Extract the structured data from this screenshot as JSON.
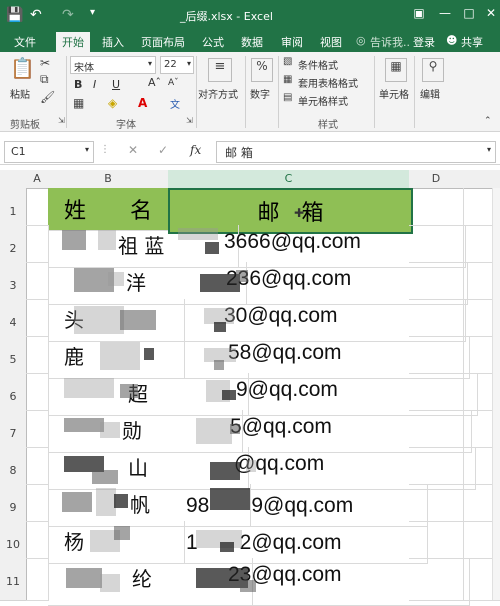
{
  "window": {
    "title": "_后缀.xlsx - Excel"
  },
  "quick_access": {
    "save_icon": "save-icon",
    "undo_icon": "undo-icon",
    "redo_icon": "redo-icon"
  },
  "tabs": [
    "文件",
    "开始",
    "插入",
    "页面布局",
    "公式",
    "数据",
    "审阅",
    "视图"
  ],
  "active_tab": "开始",
  "tell_me": "告诉我..",
  "login": "登录",
  "share": "共享",
  "ribbon": {
    "clipboard": {
      "paste": "粘贴",
      "label": "剪贴板"
    },
    "font": {
      "family": "宋体",
      "size": "22",
      "label": "字体",
      "bold": "B",
      "italic": "I",
      "underline": "U",
      "font_color_glyph": "A"
    },
    "alignment": {
      "label": "对齐方式"
    },
    "number": {
      "label": "数字",
      "glyph": "%"
    },
    "styles": {
      "conditional": "条件格式",
      "table": "套用表格格式",
      "cell_styles": "单元格样式",
      "label": "样式"
    },
    "cells": {
      "label": "单元格"
    },
    "editing": {
      "label": "编辑"
    }
  },
  "formula_bar": {
    "name_box": "C1",
    "fx": "fx",
    "content": "邮 箱"
  },
  "columns": [
    "A",
    "B",
    "C",
    "D"
  ],
  "selected_column": "C",
  "rows": [
    "1",
    "2",
    "3",
    "4",
    "5",
    "6",
    "7",
    "8",
    "9",
    "10",
    "11"
  ],
  "table": {
    "header_name": "姓　　名",
    "header_email": "邮　箱",
    "names": [
      "祖 蓝",
      "洋",
      "头",
      "鹿",
      "超",
      "勋",
      "山",
      "帆",
      "杨",
      "纶"
    ],
    "emails": [
      "3666@qq.com",
      "236@qq.com",
      "30@qq.com",
      "58@qq.com",
      "9@qq.com",
      "5@qq.com",
      "@qq.com",
      "98　　9@qq.com",
      "1　　2@qq.com",
      "23@qq.com"
    ]
  },
  "colors": {
    "excel_green": "#217346",
    "header_fill": "#8fbf55"
  }
}
